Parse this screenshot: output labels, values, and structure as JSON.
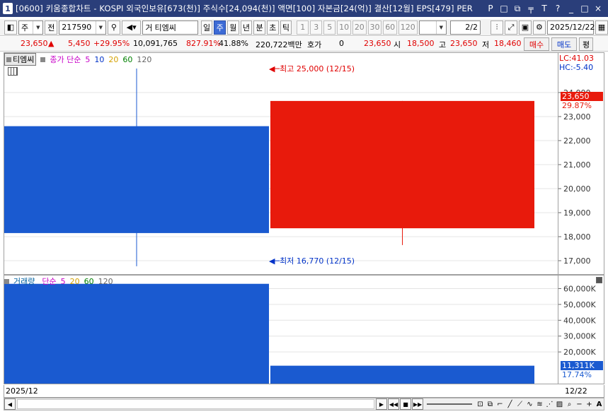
{
  "window": {
    "number": "1",
    "title": "[0600] 키움종합차트 - KOSPI 외국인보유[673(천)] 주식수[24,094(천)] 액면[100] 자본금[24(억)] 결산[12월] EPS[479] PER",
    "icons": [
      "P",
      "□",
      "⧉",
      "╤",
      "T",
      "?",
      "_",
      "□",
      "×"
    ]
  },
  "toolbar": {
    "market_select": "주",
    "prev_label": "전",
    "code": "217590",
    "stock_name_prefix": "거",
    "stock_name": "티엠씨",
    "periods": [
      "일",
      "주",
      "월",
      "년",
      "분",
      "초",
      "틱"
    ],
    "active_period": "주",
    "intervals": [
      "1",
      "3",
      "5",
      "10",
      "20",
      "30",
      "60",
      "120"
    ],
    "page": "2",
    "page_total": "/2",
    "date": "2025/12/22"
  },
  "quote": {
    "price": "23,650",
    "arrow": "▲",
    "change": "5,450",
    "change_pct": "+29.95%",
    "volume": "10,091,765",
    "volume_pct": "827.91%",
    "turnover": "41.88%",
    "amount": "220,722백만",
    "bid_label": "호가",
    "bid_value": "0",
    "ask_price": "23,650",
    "open_label": "시",
    "open": "18,500",
    "high_label": "고",
    "high": "23,650",
    "low_label": "저",
    "low": "18,460",
    "buy_button": "매수",
    "sell_button": "매도",
    "eval_button": "평"
  },
  "legend": {
    "price_box": "티엠씨",
    "price_ma_label": "종가 단순",
    "price_ma": [
      "5",
      "10",
      "20",
      "60",
      "120"
    ],
    "volume_label": "거래량",
    "volume_ma_label": "단순",
    "volume_ma": [
      "5",
      "20",
      "60",
      "120"
    ]
  },
  "annotations": {
    "high": "최고 25,000 (12/15)",
    "low": "최저 16,770 (12/15)",
    "lc": "LC:41.03",
    "hc": "HC:-5.40",
    "price_tag": "23,650",
    "price_pct": "29.87%",
    "vol_tag": "11,311K",
    "vol_pct": "17.74%"
  },
  "dates": {
    "left": "2025/12",
    "right": "12/22"
  },
  "colors": {
    "up": "#e81a0c",
    "down": "#1a5ad0",
    "titlebar": "#2a3e7a",
    "active_tab": "#3d6bd6"
  },
  "chart_data": {
    "type": "candlestick",
    "candles": [
      {
        "label": "12/15",
        "open": 22600,
        "close": 18150,
        "high": 25000,
        "low": 16770,
        "color": "down"
      },
      {
        "label": "12/22",
        "open": 18350,
        "close": 23650,
        "high": 23650,
        "low": 17650,
        "color": "up"
      }
    ],
    "price_axis": {
      "min": 16500,
      "max": 25500,
      "ticks": [
        "17,000",
        "18,000",
        "19,000",
        "20,000",
        "21,000",
        "22,000",
        "23,000",
        "24,000"
      ]
    },
    "volume": [
      {
        "label": "12/15",
        "value": 63000,
        "color": "down"
      },
      {
        "label": "12/22",
        "value": 11311,
        "color": "down"
      }
    ],
    "volume_axis": {
      "min": 0,
      "max": 66000,
      "unit": "K",
      "ticks": [
        "20,000K",
        "30,000K",
        "40,000K",
        "50,000K",
        "60,000K"
      ]
    }
  }
}
